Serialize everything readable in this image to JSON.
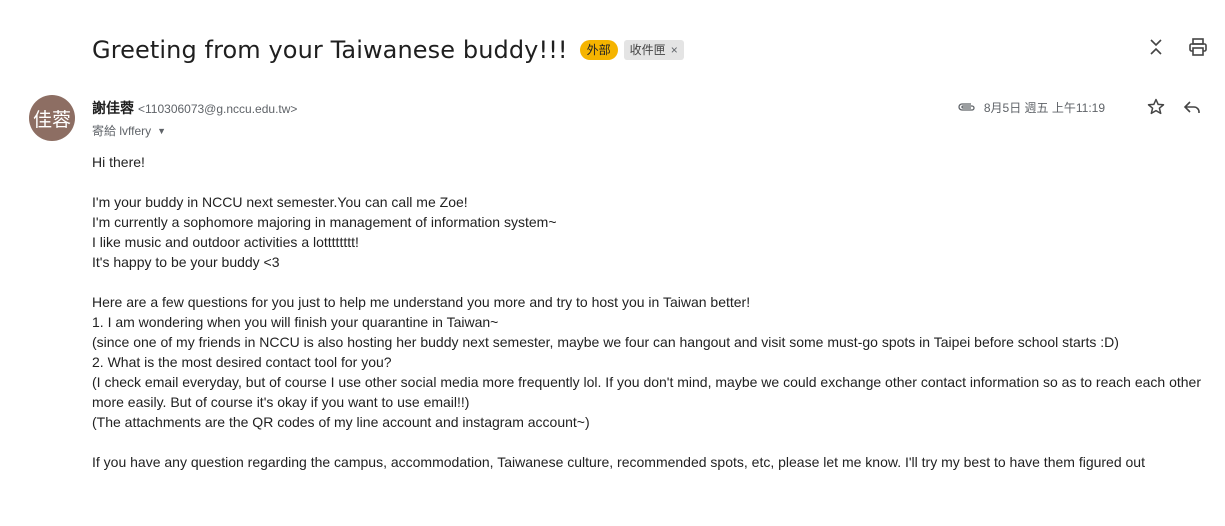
{
  "email": {
    "subject": "Greeting from your Taiwanese buddy!!!",
    "labels": {
      "external": "外部",
      "inbox": "收件匣",
      "remove": "×"
    },
    "sender": {
      "avatar_text": "佳蓉",
      "avatar_color": "#8d6e63",
      "name": "謝佳蓉",
      "email": "<110306073@g.nccu.edu.tw>",
      "to": "寄給 lvffery"
    },
    "date": "8月5日 週五 上午11:19",
    "body": {
      "greeting": "Hi there!",
      "p1": [
        "I'm your buddy in NCCU next semester.You can call me Zoe!",
        "I'm currently a sophomore majoring in management of information system~",
        "I like music and outdoor activities a lotttttttt!",
        "It's happy to be your buddy <3"
      ],
      "p2": [
        "Here are a few questions for you just to help me understand you more and try to host you in Taiwan better!",
        "1. I am wondering when you will finish your quarantine in Taiwan~",
        "(since one of my friends in NCCU is also hosting her buddy next semester, maybe we four can hangout and visit some must-go spots in Taipei before school starts :D)",
        "2. What is the most desired contact tool for you?",
        "(I check email everyday, but of course I use other social media more frequently lol. If you don't mind, maybe we could exchange other contact information so as to reach each other more easily. But of course it's okay if you want to use email!!)",
        "(The attachments are the QR codes of my line account and instagram account~)"
      ],
      "p3": "If you have any question regarding the campus, accommodation, Taiwanese culture, recommended spots, etc, please let me know. I'll try my best to have them figured out"
    }
  },
  "icons": {
    "collapse": "unfold-less-icon",
    "print": "print-icon",
    "attachment": "paperclip-icon",
    "star": "star-icon",
    "reply": "reply-icon",
    "dropdown": "chevron-down-icon"
  }
}
